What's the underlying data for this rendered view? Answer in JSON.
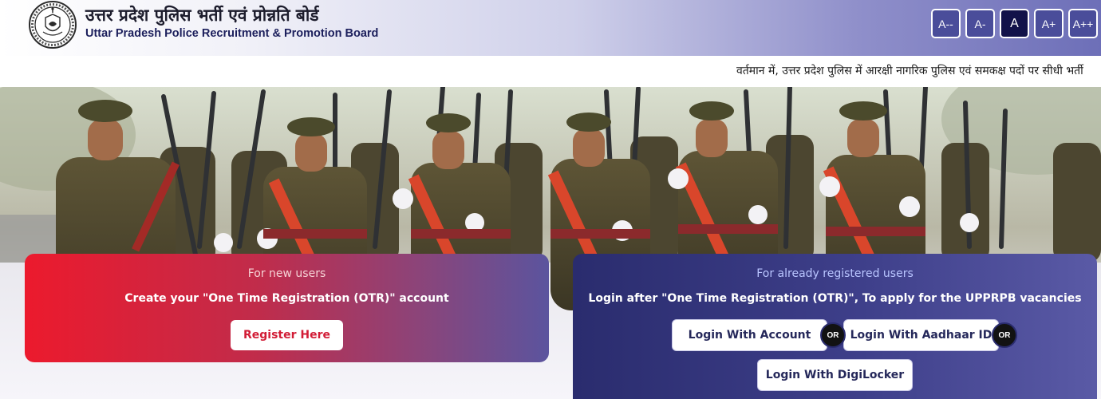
{
  "header": {
    "title_hindi": "उत्तर प्रदेश पुलिस भर्ती एवं प्रोन्नति बोर्ड",
    "title_english": "Uttar Pradesh Police Recruitment & Promotion Board",
    "logo_icon": "upprpb-emblem-icon",
    "font_controls": [
      "A--",
      "A-",
      "A",
      "A+",
      "A++"
    ],
    "active_font_control": "A"
  },
  "ticker": {
    "text": "वर्तमान में, उत्तर प्रदेश पुलिस में आरक्षी नागरिक पुलिस एवं समकक्ष पदों पर सीधी भर्ती"
  },
  "new_users": {
    "subtitle": "For new users",
    "heading": "Create your \"One Time Registration (OTR)\" account",
    "register_button": "Register Here"
  },
  "registered_users": {
    "subtitle": "For already registered users",
    "heading": "Login after \"One Time Registration (OTR)\", To apply for the UPPRPB vacancies",
    "login_account_button": "Login With Account",
    "or_label_1": "OR",
    "login_aadhaar_button": "Login With Aadhaar ID",
    "or_label_2": "OR",
    "login_digilocker_button": "Login With DigiLocker"
  },
  "colors": {
    "header_gradient_end": "#6d6fb8",
    "new_users_gradient_start": "#ec1a2d",
    "new_users_gradient_end": "#5b549e",
    "registered_gradient_start": "#2a2c6e",
    "register_text": "#d21c36",
    "login_text": "#25285a"
  }
}
